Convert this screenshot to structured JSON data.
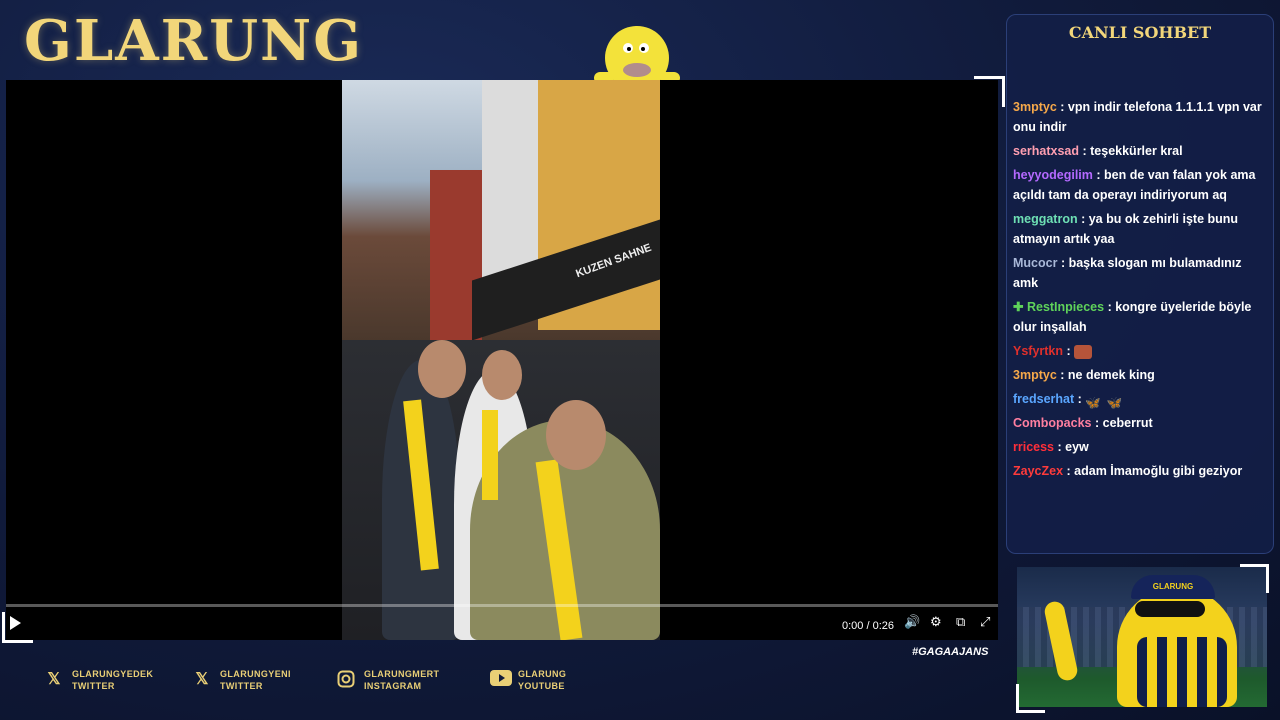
{
  "brand": {
    "logo_text": "GLARUNG"
  },
  "player": {
    "time": "0:00 / 0:26",
    "sign_text": "KUZEN SAHNE",
    "hashtag": "#GAGAAJANS"
  },
  "socials": [
    {
      "icon": "x-icon",
      "line1": "GLARUNGYEDEK",
      "line2": "TWITTER"
    },
    {
      "icon": "x-icon",
      "line1": "GLARUNGYENI",
      "line2": "TWITTER"
    },
    {
      "icon": "instagram-icon",
      "line1": "GLARUNGMERT",
      "line2": "INSTAGRAM"
    },
    {
      "icon": "youtube-icon",
      "line1": "GLARUNG",
      "line2": "YOUTUBE"
    }
  ],
  "chat": {
    "title": "CANLI SOHBET",
    "messages": [
      {
        "user": "3mptyc",
        "color": "#f5a84a",
        "text": ": vpn indir telefona 1.1.1.1 vpn var onu indir"
      },
      {
        "user": "serhatxsad",
        "color": "#ff9fb1",
        "text": ": teşekkürler kral"
      },
      {
        "user": "heyyodegilim",
        "color": "#b469ff",
        "text": ": ben de van falan yok ama açıldı tam da operayı indiriyorum aq"
      },
      {
        "user": "meggatron",
        "color": "#6ee0b4",
        "text": ": ya bu ok zehirli işte bunu atmayın artık yaa"
      },
      {
        "user": "Mucocr",
        "color": "#a9b8d8",
        "text": ": başka slogan mı bulamadınız amk"
      },
      {
        "user": "RestInpieces",
        "color": "#5fd35a",
        "text": ": kongre üyeleride böyle olur inşallah"
      },
      {
        "user": "Ysfyrtkn",
        "color": "#e0302c",
        "text": ":"
      },
      {
        "user": "3mptyc",
        "color": "#f5a84a",
        "text": ": ne demek king"
      },
      {
        "user": "fredserhat",
        "color": "#5aa6ff",
        "text": ":"
      },
      {
        "user": "Combopacks",
        "color": "#ff7fa0",
        "text": ": ceberrut"
      },
      {
        "user": "rricess",
        "color": "#ff2f3a",
        "text": ": eyw"
      },
      {
        "user": "ZaycZex",
        "color": "#ff3b3b",
        "text": ": adam İmamoğlu gibi geziyor"
      }
    ]
  },
  "webcam": {
    "cap_text": "GLARUNG"
  },
  "colors": {
    "accent_gold": "#f2d67a",
    "panel_bg": "#121e46"
  }
}
